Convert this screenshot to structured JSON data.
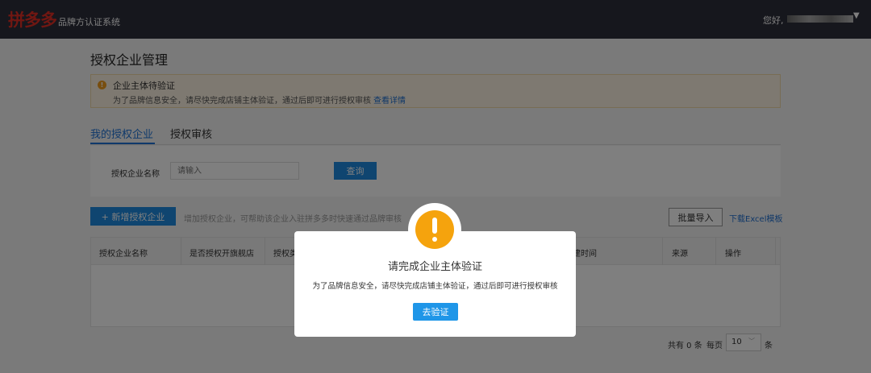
{
  "header": {
    "logo_text": "拼多多",
    "system_name": "品牌方认证系统",
    "greeting": "您好,"
  },
  "page": {
    "title": "授权企业管理"
  },
  "notice": {
    "title": "企业主体待验证",
    "description": "为了品牌信息安全，请尽快完成店铺主体验证，通过后即可进行授权审核",
    "link": "查看详情"
  },
  "tabs": [
    {
      "label": "我的授权企业",
      "active": true
    },
    {
      "label": "授权审核",
      "active": false
    }
  ],
  "filter": {
    "label": "授权企业名称",
    "placeholder": "请输入",
    "query_label": "查询"
  },
  "actions": {
    "add_label": "+ 新增授权企业",
    "add_hint": "增加授权企业，可帮助该企业入驻拼多多时快速通过品牌审核",
    "batch_import_label": "批量导入",
    "download_template_label": "下载Excel模板"
  },
  "table": {
    "columns": [
      "授权企业名称",
      "是否授权开旗舰店",
      "授权类",
      "",
      "建时间",
      "来源",
      "操作"
    ],
    "rows": []
  },
  "pagination": {
    "total_text": "共有 0 条",
    "per_page_label": "每页",
    "per_page_value": "10",
    "unit": "条"
  },
  "modal": {
    "title": "请完成企业主体验证",
    "description": "为了品牌信息安全，请尽快完成店铺主体验证，通过后即可进行授权审核",
    "button_label": "去验证"
  },
  "colors": {
    "topbar": "#2d2e3a",
    "brand_red": "#e02e24",
    "primary_blue": "#1f8ae0",
    "warning_orange": "#f5a30d"
  }
}
